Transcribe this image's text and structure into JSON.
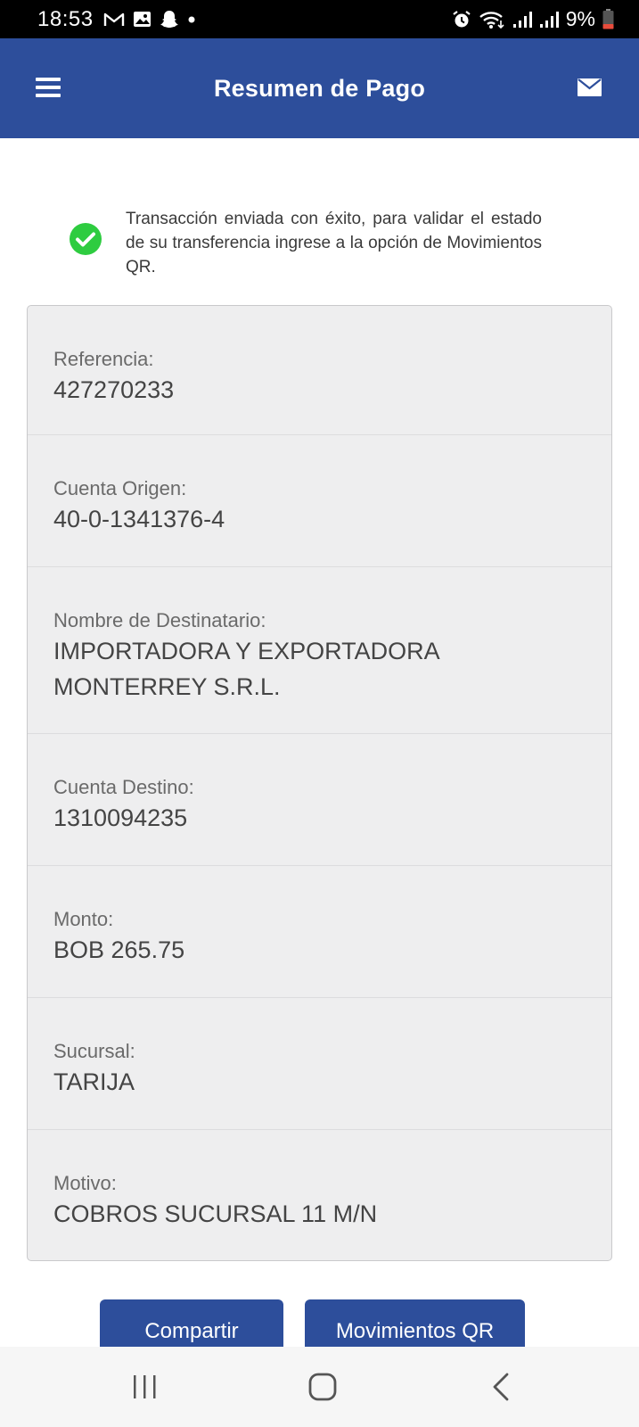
{
  "status_bar": {
    "time": "18:53",
    "battery": "9%",
    "icons": [
      "gmail-icon",
      "gallery-icon",
      "snapchat-icon",
      "dot-icon",
      "alarm-icon",
      "wifi-icon",
      "signal-icon",
      "signal-icon",
      "battery-icon"
    ]
  },
  "app_bar": {
    "title": "Resumen de Pago",
    "left_icon": "menu-icon",
    "right_icon": "mail-icon",
    "color": "#2d4e9b"
  },
  "success": {
    "icon": "check-circle-icon",
    "icon_color": "#2ecc40",
    "message": "Transacción enviada con éxito, para validar el estado de su transferencia ingrese a la opción de Movimientos QR."
  },
  "details": [
    {
      "label": "Referencia:",
      "value": "427270233"
    },
    {
      "label": "Cuenta Origen:",
      "value": "40-0-1341376-4"
    },
    {
      "label": "Nombre de Destinatario:",
      "value": "IMPORTADORA Y EXPORTADORA MONTERREY S.R.L."
    },
    {
      "label": "Cuenta Destino:",
      "value": "1310094235"
    },
    {
      "label": "Monto:",
      "value": "BOB 265.75"
    },
    {
      "label": "Sucursal:",
      "value": "TARIJA"
    },
    {
      "label": "Motivo:",
      "value": "COBROS SUCURSAL 11 M/N"
    }
  ],
  "actions": {
    "share_label": "Compartir",
    "movements_label": "Movimientos QR"
  },
  "nav_bar": {
    "icons": [
      "recents-icon",
      "home-icon",
      "back-icon"
    ]
  }
}
